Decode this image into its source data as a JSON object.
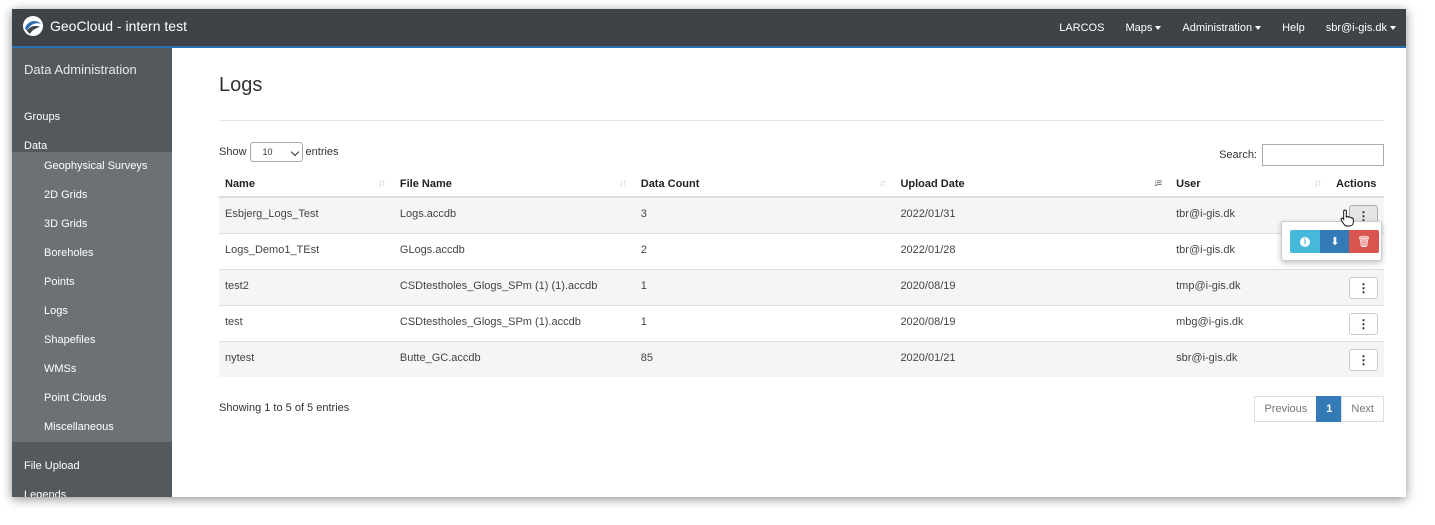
{
  "app": {
    "title": "GeoCloud - intern test"
  },
  "nav": {
    "items": [
      {
        "label": "LARCOS",
        "dropdown": false
      },
      {
        "label": "Maps",
        "dropdown": true
      },
      {
        "label": "Administration",
        "dropdown": true
      },
      {
        "label": "Help",
        "dropdown": false
      },
      {
        "label": "sbr@i-gis.dk",
        "dropdown": true
      }
    ]
  },
  "sidebar": {
    "heading": "Data Administration",
    "top_items": [
      "Groups",
      "Data"
    ],
    "sub_items": [
      "Geophysical Surveys",
      "2D Grids",
      "3D Grids",
      "Boreholes",
      "Points",
      "Logs",
      "Shapefiles",
      "WMSs",
      "Point Clouds",
      "Miscellaneous"
    ],
    "bottom_items": [
      "File Upload",
      "Legends"
    ]
  },
  "page": {
    "title": "Logs",
    "show_label": "Show",
    "entries_value": "10",
    "entries_label": "entries",
    "search_label": "Search:",
    "search_value": ""
  },
  "table": {
    "columns": [
      "Name",
      "File Name",
      "Data Count",
      "Upload Date",
      "User",
      "Actions"
    ],
    "rows": [
      {
        "name": "Esbjerg_Logs_Test",
        "file": "Logs.accdb",
        "count": "3",
        "date": "2022/01/31",
        "user": "tbr@i-gis.dk"
      },
      {
        "name": "Logs_Demo1_TEst",
        "file": "GLogs.accdb",
        "count": "2",
        "date": "2022/01/28",
        "user": "tbr@i-gis.dk"
      },
      {
        "name": "test2",
        "file": "CSDtestholes_Glogs_SPm (1) (1).accdb",
        "count": "1",
        "date": "2020/08/19",
        "user": "tmp@i-gis.dk"
      },
      {
        "name": "test",
        "file": "CSDtestholes_Glogs_SPm (1).accdb",
        "count": "1",
        "date": "2020/08/19",
        "user": "mbg@i-gis.dk"
      },
      {
        "name": "nytest",
        "file": "Butte_GC.accdb",
        "count": "85",
        "date": "2020/01/21",
        "user": "sbr@i-gis.dk"
      }
    ],
    "action_glyph": "⋮"
  },
  "popup": {
    "info_glyph": "i",
    "download_glyph": "⬇",
    "delete_glyph": "🗑"
  },
  "footer": {
    "info": "Showing 1 to 5 of 5 entries",
    "previous": "Previous",
    "page": "1",
    "next": "Next"
  },
  "colors": {
    "topbar": "#3d4347",
    "sidebar": "#53595d",
    "sidebar_sub": "#6c7175",
    "primary": "#337ab7",
    "info": "#46b8da",
    "danger": "#d9534f"
  }
}
